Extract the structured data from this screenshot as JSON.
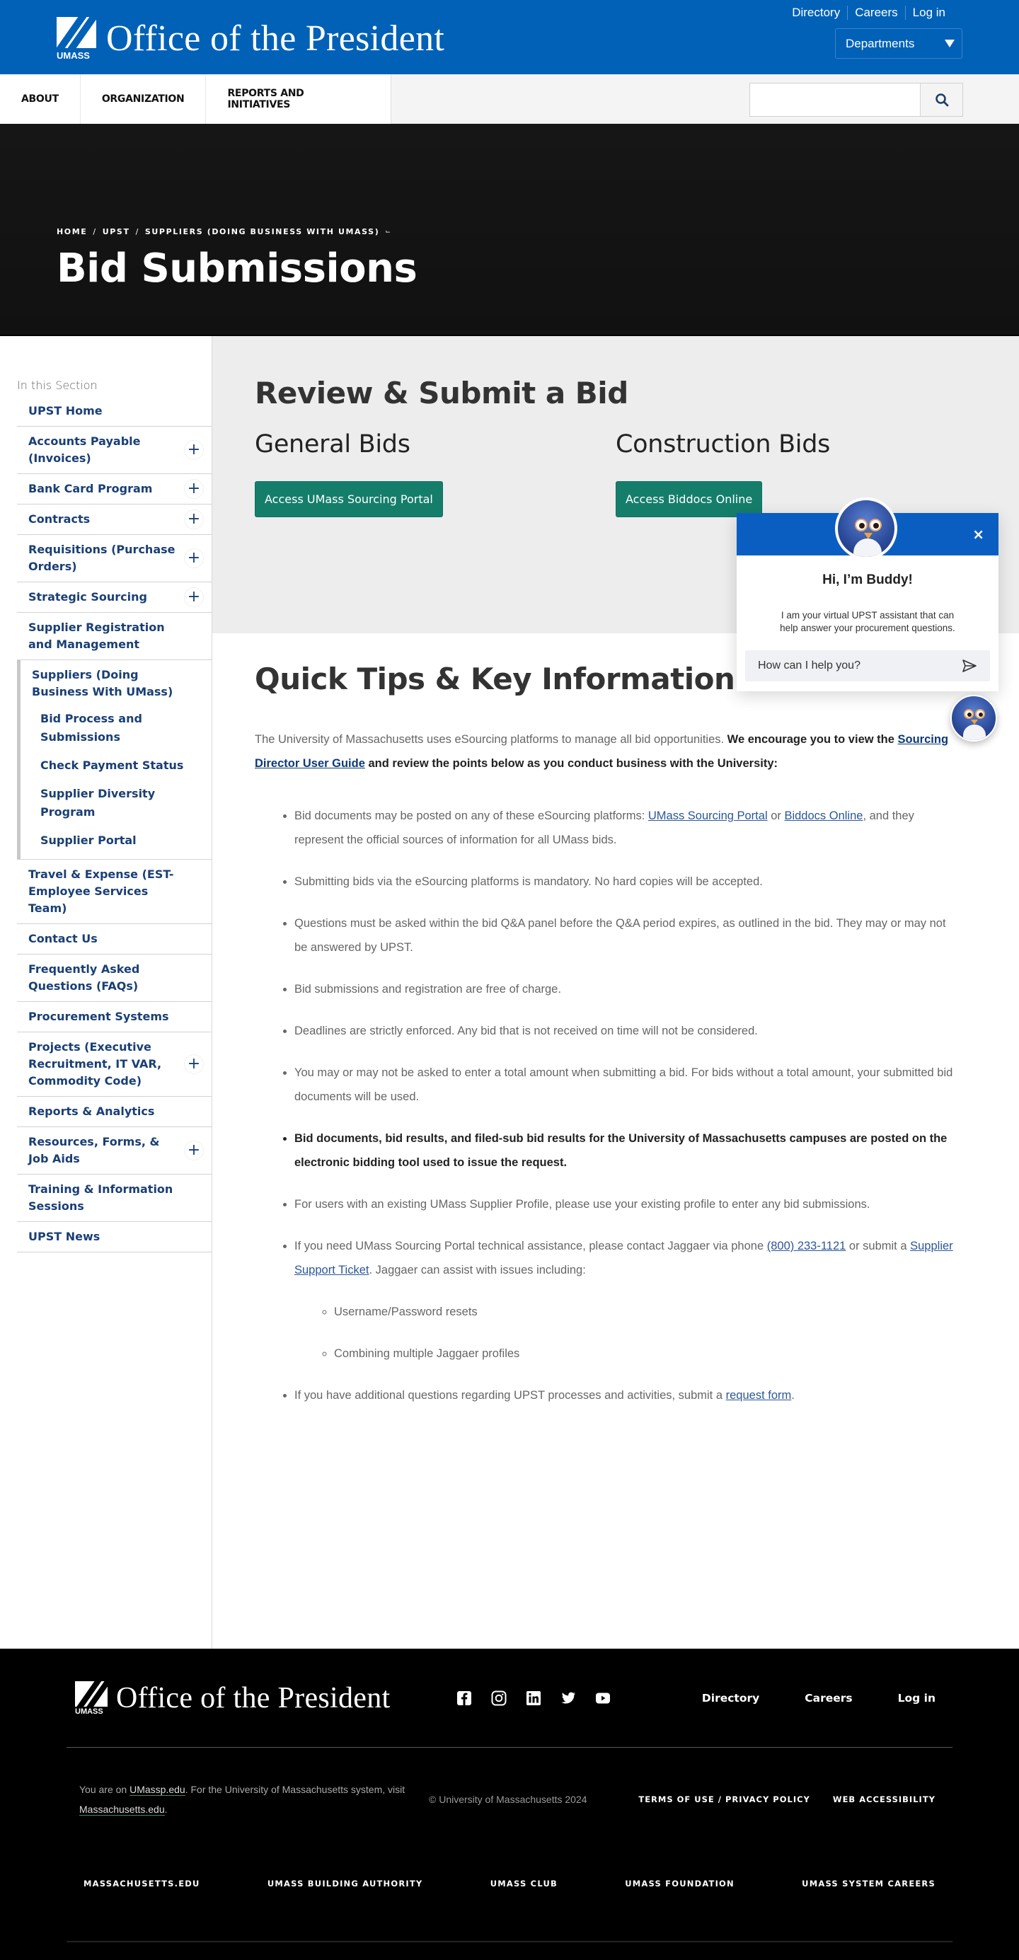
{
  "header": {
    "brand_title": "Office of the President",
    "logo_text": "UMASS",
    "utility_links": [
      "Directory",
      "Careers",
      "Log in"
    ],
    "departments_label": "Departments"
  },
  "nav": {
    "tabs": [
      "ABOUT",
      "ORGANIZATION",
      "REPORTS AND INITIATIVES"
    ],
    "search_placeholder": "",
    "search_icon": "search-icon"
  },
  "hero": {
    "breadcrumb": [
      "HOME",
      "UPST",
      "SUPPLIERS (DOING BUSINESS WITH UMASS)"
    ],
    "title": "Bid Submissions"
  },
  "sidebar": {
    "section_label": "In this Section",
    "items_top": [
      {
        "label": "UPST Home",
        "expandable": false
      },
      {
        "label": "Accounts Payable (Invoices)",
        "expandable": true
      },
      {
        "label": "Bank Card Program",
        "expandable": true
      },
      {
        "label": "Contracts",
        "expandable": true
      },
      {
        "label": "Requisitions (Purchase Orders)",
        "expandable": true
      },
      {
        "label": "Strategic Sourcing",
        "expandable": true
      },
      {
        "label": "Supplier Registration and Management",
        "expandable": false
      }
    ],
    "subgroup": {
      "head": "Suppliers (Doing Business With UMass)",
      "items": [
        "Bid Process and Submissions",
        "Check Payment Status",
        "Supplier Diversity Program",
        "Supplier Portal"
      ]
    },
    "items_bottom": [
      {
        "label": "Travel & Expense (EST-Employee Services Team)",
        "expandable": false
      },
      {
        "label": "Contact Us",
        "expandable": false
      },
      {
        "label": "Frequently Asked Questions (FAQs)",
        "expandable": false
      },
      {
        "label": "Procurement Systems",
        "expandable": false
      },
      {
        "label": "Projects (Executive Recruitment, IT VAR, Commodity Code)",
        "expandable": true
      },
      {
        "label": "Reports & Analytics",
        "expandable": false
      },
      {
        "label": "Resources, Forms, & Job Aids",
        "expandable": true
      },
      {
        "label": "Training & Information Sessions",
        "expandable": false
      },
      {
        "label": "UPST News",
        "expandable": false
      }
    ]
  },
  "bids": {
    "heading": "Review & Submit a Bid",
    "general": {
      "title": "General Bids",
      "button": "Access UMass Sourcing Portal"
    },
    "construction": {
      "title": "Construction Bids",
      "button": "Access Biddocs Online"
    }
  },
  "tips": {
    "heading": "Quick Tips & Key Information",
    "intro_plain": "The University of Massachusetts uses eSourcing platforms to manage all bid opportunities. ",
    "intro_bold_1": "We encourage you to view the ",
    "intro_link": "Sourcing Director User Guide",
    "intro_bold_2": " and review the points below as you conduct business with the University:",
    "item1_a": "Bid documents may be posted on any of these eSourcing platforms: ",
    "item1_link1": "UMass Sourcing Portal",
    "item1_b": " or ",
    "item1_link2": "Biddocs Online",
    "item1_c": ", and they represent the official sources of information for all UMass bids.",
    "item2": "Submitting bids via the eSourcing platforms is mandatory. No hard copies will be accepted.",
    "item3": "Questions must be asked within the bid Q&A panel before the Q&A period expires, as outlined in the bid. They may or may not be answered by UPST.",
    "item4": "Bid submissions and registration are free of charge.",
    "item5": "Deadlines are strictly enforced. Any bid that is not received on time will not be considered.",
    "item6": "You may or may not be asked to enter a total amount when submitting a bid. For bids without a total amount, your submitted bid documents will be used.",
    "item7": "Bid documents, bid results, and filed-sub bid results for the University of Massachusetts campuses are posted on the electronic bidding tool used to issue the request.",
    "item8": "For users with an existing UMass Supplier Profile, please use your existing profile to enter any bid submissions.",
    "item9_a": "If you need UMass Sourcing Portal technical assistance, please contact Jaggaer via phone ",
    "item9_phone": "(800) 233-1121",
    "item9_b": " or submit a ",
    "item9_link": "Supplier Support Ticket",
    "item9_c": ". Jaggaer can assist with issues including:",
    "subitems": [
      "Username/Password resets",
      "Combining multiple Jaggaer profiles"
    ],
    "item10_a": "If you have additional questions regarding UPST processes and activities, submit a ",
    "item10_link": "request form",
    "item10_b": "."
  },
  "chat": {
    "greeting": "Hi, I’m Buddy!",
    "description": "I am your virtual UPST assistant that can help answer your procurement questions.",
    "input_placeholder": "How can I help you?",
    "close_label": "×"
  },
  "footer": {
    "brand_title": "Office of the President",
    "logo_text": "UMASS",
    "social": [
      "facebook-icon",
      "instagram-icon",
      "linkedin-icon",
      "twitter-icon",
      "youtube-icon"
    ],
    "links": [
      "Directory",
      "Careers",
      "Log in"
    ],
    "note_a": "You are on ",
    "note_link1": "UMassp.edu",
    "note_b": ". For the University of Massachusetts system, visit ",
    "note_link2": "Massachusetts.edu",
    "note_c": ".",
    "copyright": "© University of Massachusetts 2024",
    "legal": [
      "TERMS OF USE / PRIVACY POLICY",
      "WEB ACCESSIBILITY"
    ],
    "bottom_links": [
      "MASSACHUSETTS.EDU",
      "UMASS BUILDING AUTHORITY",
      "UMASS CLUB",
      "UMASS FOUNDATION",
      "UMASS SYSTEM CAREERS"
    ]
  },
  "colors": {
    "brand_blue": "#0061b7",
    "button_green": "#157e6b",
    "nav_link": "#1a3f75",
    "chat_header": "#0a5ec2"
  }
}
